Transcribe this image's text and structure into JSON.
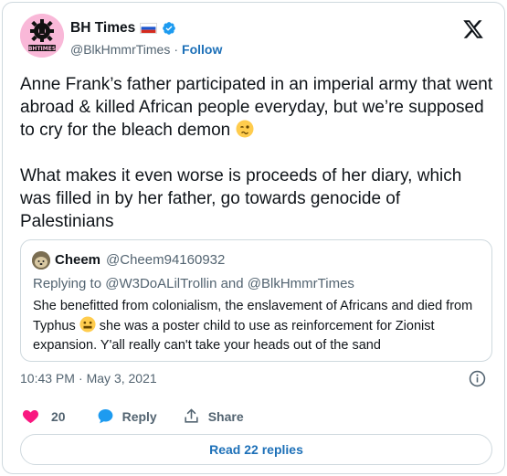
{
  "author": {
    "name": "BH Times",
    "handle": "@BlkHmmrTimes",
    "follow_label": "Follow",
    "flag_icon": "russia-flag-icon",
    "verified_icon": "verified-badge-icon",
    "avatar_text": "BHTIMES"
  },
  "tweet": {
    "paragraph1": "Anne Frank’s father participated in an imperial army that went abroad & killed African people everyday, but we’re supposed to cry for the bleach demon ",
    "paragraph1_emoji": "woozy-face-emoji",
    "paragraph2": "What makes it even worse is proceeds of her diary, which was filled in by her father, go towards genocide of Palestinians"
  },
  "quote": {
    "name": "Cheem",
    "handle": "@Cheem94160932",
    "replying_to": "Replying to @W3DoALilTrollin and @BlkHmmrTimes",
    "text_part1": "She benefitted from colonialism, the enslavement of Africans and died from Typhus ",
    "text_emoji": "grimacing-face-emoji",
    "text_part2": " she was a poster child to use as reinforcement for Zionist expansion. Y'all really can't take your heads out of the sand"
  },
  "meta": {
    "time": "10:43 PM",
    "separator": "·",
    "date": "May 3, 2021"
  },
  "actions": {
    "like_count": "20",
    "reply_label": "Reply",
    "share_label": "Share"
  },
  "read_replies_label": "Read 22 replies",
  "colors": {
    "like_red": "#f91880",
    "link_blue": "#1d70b8",
    "verified_blue": "#1d9bf0",
    "muted": "#536471",
    "border": "#cfd9de"
  }
}
